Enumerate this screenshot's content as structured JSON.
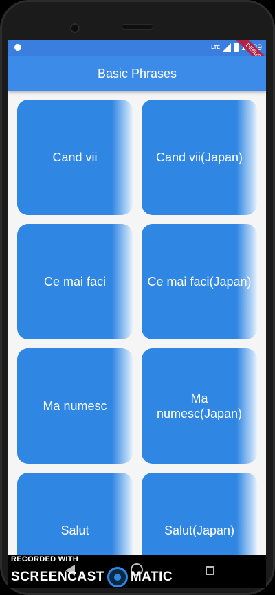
{
  "status_bar": {
    "network_label": "LTE",
    "time": "12:39",
    "ribbon": "DEBUG"
  },
  "app_bar": {
    "title": "Basic Phrases"
  },
  "tiles": [
    {
      "label": "Cand vii"
    },
    {
      "label": "Cand vii(Japan)"
    },
    {
      "label": "Ce mai faci"
    },
    {
      "label": "Ce mai faci(Japan)"
    },
    {
      "label": "Ma numesc"
    },
    {
      "label": "Ma numesc(Japan)"
    },
    {
      "label": "Salut"
    },
    {
      "label": "Salut(Japan)"
    }
  ],
  "watermark": {
    "top": "RECORDED WITH",
    "left": "SCREENCAST",
    "right": "MATIC"
  },
  "colors": {
    "app_bar": "#3d8be8",
    "tile": "#2f86e3",
    "status_bar": "#3a7fe0"
  }
}
